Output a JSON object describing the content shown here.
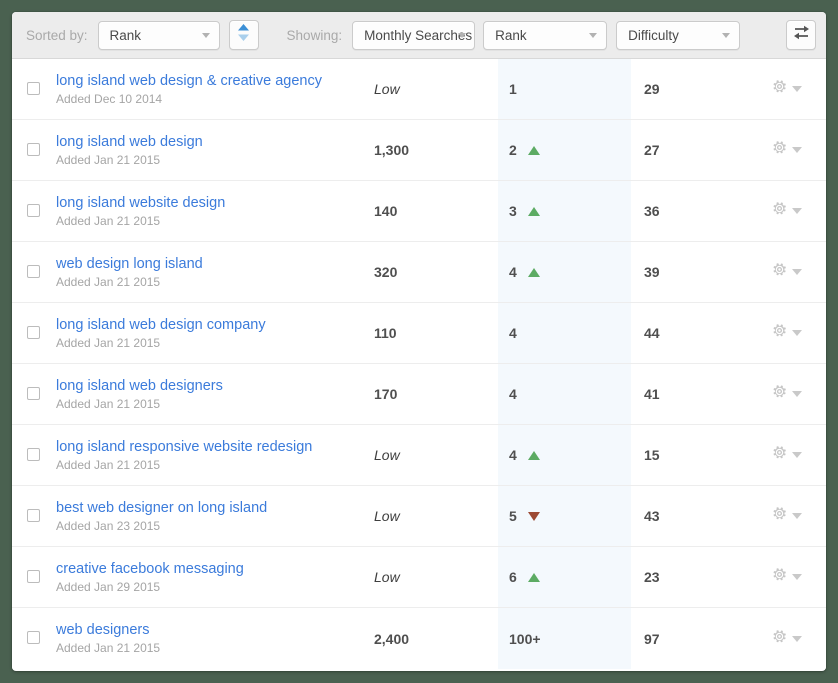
{
  "toolbar": {
    "sorted_by_label": "Sorted by:",
    "sort_field": "Rank",
    "sort_direction_icon": "sort-updown-icon",
    "showing_label": "Showing:",
    "column_1": "Monthly Searches",
    "column_2": "Rank",
    "column_3": "Difficulty",
    "swap_icon": "swap-arrows-icon"
  },
  "colors": {
    "page_background": "#4a6150",
    "toolbar_background": "#ececec",
    "link": "#3b7bdb",
    "rank_column_highlight": "#f4f9fd",
    "rank_up": "#5cab63",
    "rank_down": "#9c4a34",
    "muted_text": "#a5a5a5"
  },
  "table": {
    "rows": [
      {
        "keyword": "long island web design & creative agency",
        "added": "Added Dec 10 2014",
        "searches": "Low",
        "searches_is_low": true,
        "rank": "1",
        "trend": "none",
        "difficulty": "29"
      },
      {
        "keyword": "long island web design",
        "added": "Added Jan 21 2015",
        "searches": "1,300",
        "searches_is_low": false,
        "rank": "2",
        "trend": "up",
        "difficulty": "27"
      },
      {
        "keyword": "long island website design",
        "added": "Added Jan 21 2015",
        "searches": "140",
        "searches_is_low": false,
        "rank": "3",
        "trend": "up",
        "difficulty": "36"
      },
      {
        "keyword": "web design long island",
        "added": "Added Jan 21 2015",
        "searches": "320",
        "searches_is_low": false,
        "rank": "4",
        "trend": "up",
        "difficulty": "39"
      },
      {
        "keyword": "long island web design company",
        "added": "Added Jan 21 2015",
        "searches": "110",
        "searches_is_low": false,
        "rank": "4",
        "trend": "none",
        "difficulty": "44"
      },
      {
        "keyword": "long island web designers",
        "added": "Added Jan 21 2015",
        "searches": "170",
        "searches_is_low": false,
        "rank": "4",
        "trend": "none",
        "difficulty": "41"
      },
      {
        "keyword": "long island responsive website redesign",
        "added": "Added Jan 21 2015",
        "searches": "Low",
        "searches_is_low": true,
        "rank": "4",
        "trend": "up",
        "difficulty": "15"
      },
      {
        "keyword": "best web designer on long island",
        "added": "Added Jan 23 2015",
        "searches": "Low",
        "searches_is_low": true,
        "rank": "5",
        "trend": "down",
        "difficulty": "43"
      },
      {
        "keyword": "creative facebook messaging",
        "added": "Added Jan 29 2015",
        "searches": "Low",
        "searches_is_low": true,
        "rank": "6",
        "trend": "up",
        "difficulty": "23"
      },
      {
        "keyword": "web designers",
        "added": "Added Jan 21 2015",
        "searches": "2,400",
        "searches_is_low": false,
        "rank": "100+",
        "trend": "none",
        "difficulty": "97"
      }
    ],
    "row_action_icon": "gear-icon",
    "row_action_caret_icon": "caret-down-icon",
    "row_select_icon": "checkbox-unchecked-icon"
  }
}
